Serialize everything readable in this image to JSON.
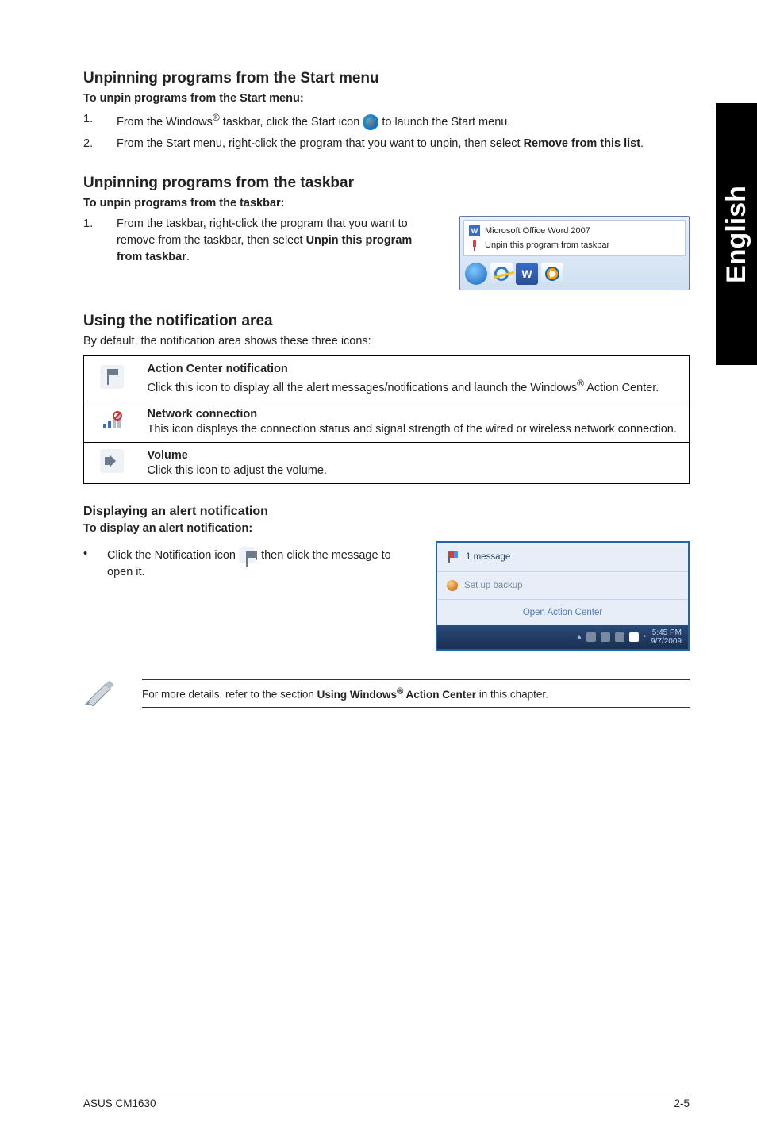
{
  "eng_tab": "English",
  "sec1": {
    "title": "Unpinning programs from the Start menu",
    "sub": "To unpin programs from the Start menu:",
    "step1_a": "From the Windows",
    "step1_b": " taskbar, click the Start icon ",
    "step1_c": " to launch the Start menu.",
    "step2_a": "From the Start menu, right-click the program that you want to unpin, then select ",
    "step2_b": "Remove from this list",
    "step2_c": "."
  },
  "sec2": {
    "title": "Unpinning programs from the taskbar",
    "sub": "To unpin programs from the taskbar:",
    "step1_a": "From the taskbar, right-click the program that you want to remove from the taskbar, then select ",
    "step1_b": "Unpin this program from taskbar",
    "step1_c": ".",
    "shot_menu1": "Microsoft Office Word 2007",
    "shot_menu2": "Unpin this program from taskbar"
  },
  "sec3": {
    "title": "Using the notification area",
    "intro": "By default, the notification area shows these three icons:",
    "r1_title": "Action Center notification",
    "r1_body_a": "Click this icon to display all the alert messages/notifications and launch the Windows",
    "r1_body_b": " Action Center.",
    "r2_title": "Network connection",
    "r2_body": "This icon displays the connection status and signal strength of the wired or wireless network connection.",
    "r3_title": "Volume",
    "r3_body": "Click this icon to adjust the volume."
  },
  "sec4": {
    "title": "Displaying an alert notification",
    "sub": "To display an alert notification:",
    "bullet_a": "Click the Notification icon ",
    "bullet_b": ", then click the message to open it.",
    "alert_msg": "1 message",
    "alert_backup": "Set up backup",
    "alert_action": "Open Action Center",
    "alert_time": "5:45 PM",
    "alert_date": "9/7/2009"
  },
  "note": {
    "a": "For more details, refer to the section ",
    "b": "Using Windows",
    "c": " Action Center",
    "d": " in this chapter."
  },
  "footer": {
    "left": "ASUS CM1630",
    "right": "2-5"
  },
  "nums": {
    "one": "1.",
    "two": "2."
  },
  "reg": "®",
  "bullet": "•"
}
